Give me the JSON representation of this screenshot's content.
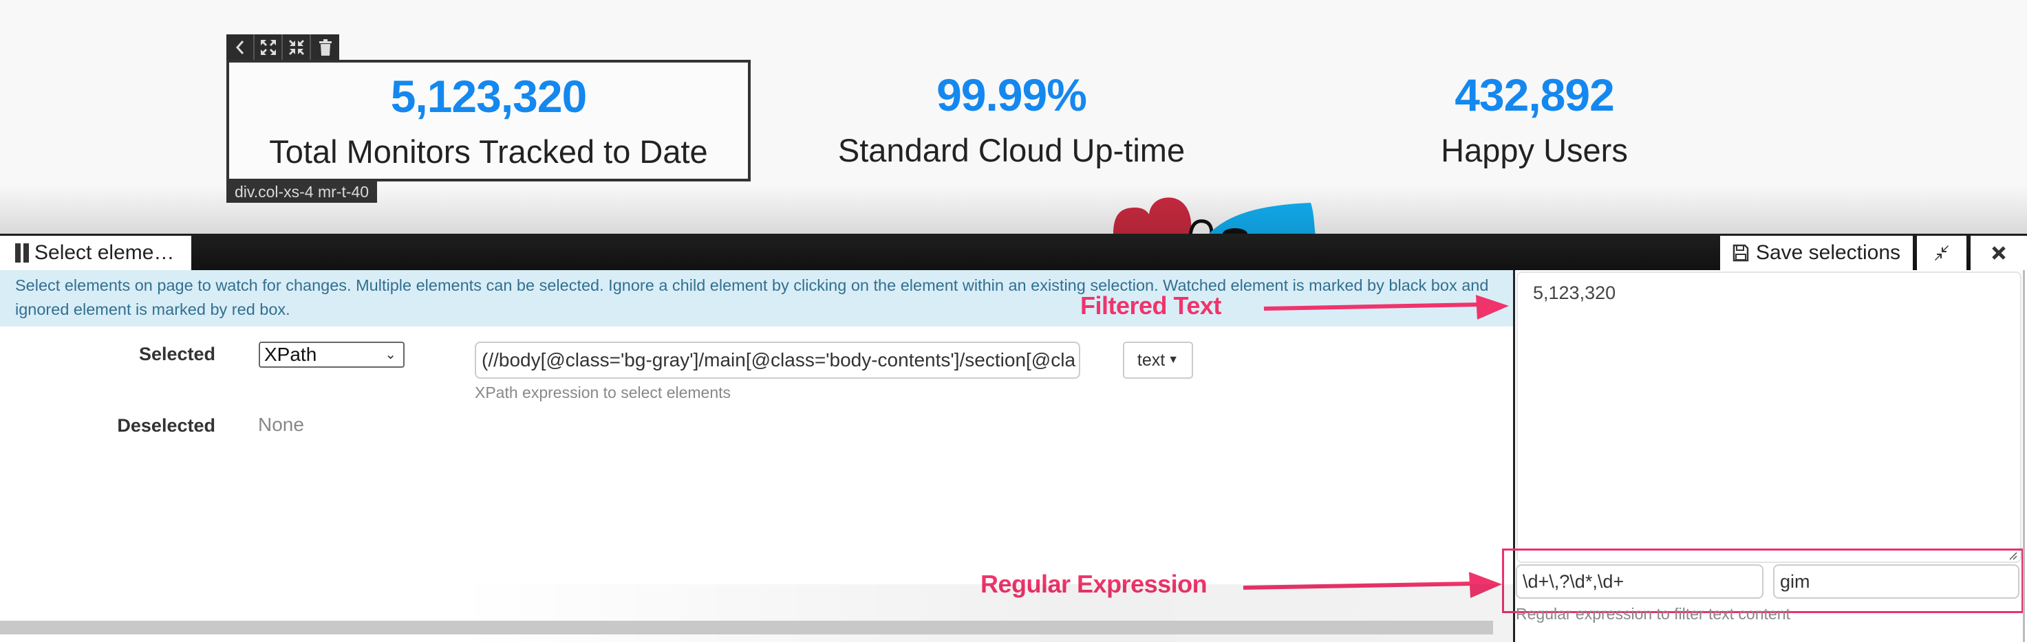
{
  "page": {
    "stats": [
      {
        "value": "5,123,320",
        "label": "Total Monitors Tracked to Date"
      },
      {
        "value": "99.99%",
        "label": "Standard Cloud Up-time"
      },
      {
        "value": "432,892",
        "label": "Happy Users"
      }
    ],
    "element_toolbar": {
      "icons": [
        "chevron-left-icon",
        "expand-icon",
        "compress-icon",
        "trash-icon"
      ]
    },
    "element_tag": "div.col-xs-4 mr-t-40"
  },
  "panel": {
    "mode_tab": {
      "label": "Select eleme…",
      "icon": "pause-icon"
    },
    "save_button": {
      "label": "Save selections",
      "icon": "floppy-disk-icon"
    },
    "compress_button": {
      "icon": "compress-icon"
    },
    "close_button": {
      "icon": "close-icon"
    },
    "info_text": "Select elements on page to watch for changes. Multiple elements can be selected. Ignore a child element by clicking on the element within an existing selection. Watched element is marked by black box and ignored element is marked by red box.",
    "selected": {
      "label": "Selected",
      "selector_type": "XPath",
      "expression": "(//body[@class='bg-gray']/main[@class='body-contents']/section[@cla",
      "expression_help": "XPath expression to select elements",
      "content_type": "text"
    },
    "deselected": {
      "label": "Deselected",
      "value": "None"
    },
    "filtered_text": "5,123,320",
    "regex": {
      "pattern": "\\d+\\,?\\d*,\\d+",
      "flags": "gim",
      "help": "Regular expression to filter text content"
    }
  },
  "annotations": {
    "filtered_text": "Filtered Text",
    "regular_expression": "Regular Expression",
    "color": "#f0346b"
  },
  "colors": {
    "stat_number": "#1488ef",
    "info_bg": "#d9edf7",
    "info_text": "#31708f",
    "toolbar_bg": "#111111"
  }
}
